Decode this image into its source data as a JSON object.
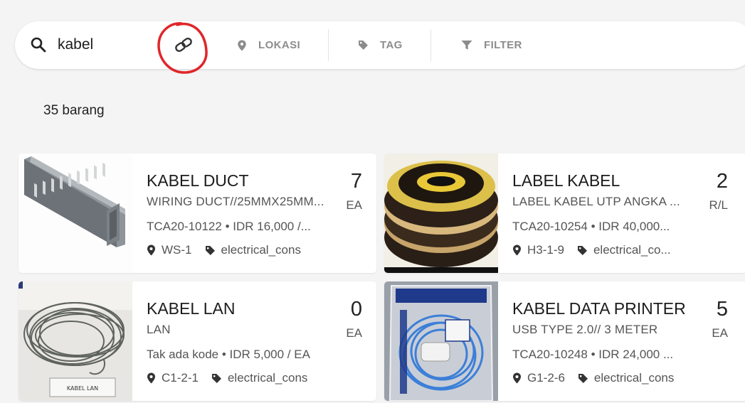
{
  "search": {
    "value": "kabel"
  },
  "filters": {
    "location": "LOKASI",
    "tag": "TAG",
    "filter": "FILTER"
  },
  "result_count": "35 barang",
  "items": [
    {
      "name": "KABEL DUCT",
      "description": "WIRING DUCT//25MMX25MM...",
      "code_price": "TCA20-10122 • IDR 16,000 /...",
      "location": "WS-1",
      "category": "electrical_cons",
      "quantity": "7",
      "unit": "EA"
    },
    {
      "name": "LABEL KABEL",
      "description": "LABEL KABEL UTP ANGKA ...",
      "code_price": "TCA20-10254 • IDR 40,000...",
      "location": "H3-1-9",
      "category": "electrical_co...",
      "quantity": "2",
      "unit": "R/L"
    },
    {
      "name": "KABEL LAN",
      "description": "LAN",
      "code_price": "Tak ada kode • IDR 5,000 / EA",
      "location": "C1-2-1",
      "category": "electrical_cons",
      "quantity": "0",
      "unit": "EA"
    },
    {
      "name": "KABEL DATA PRINTER",
      "description": "USB TYPE 2.0// 3 METER",
      "code_price": "TCA20-10248 • IDR 24,000 ...",
      "location": "G1-2-6",
      "category": "electrical_cons",
      "quantity": "5",
      "unit": "EA"
    }
  ]
}
